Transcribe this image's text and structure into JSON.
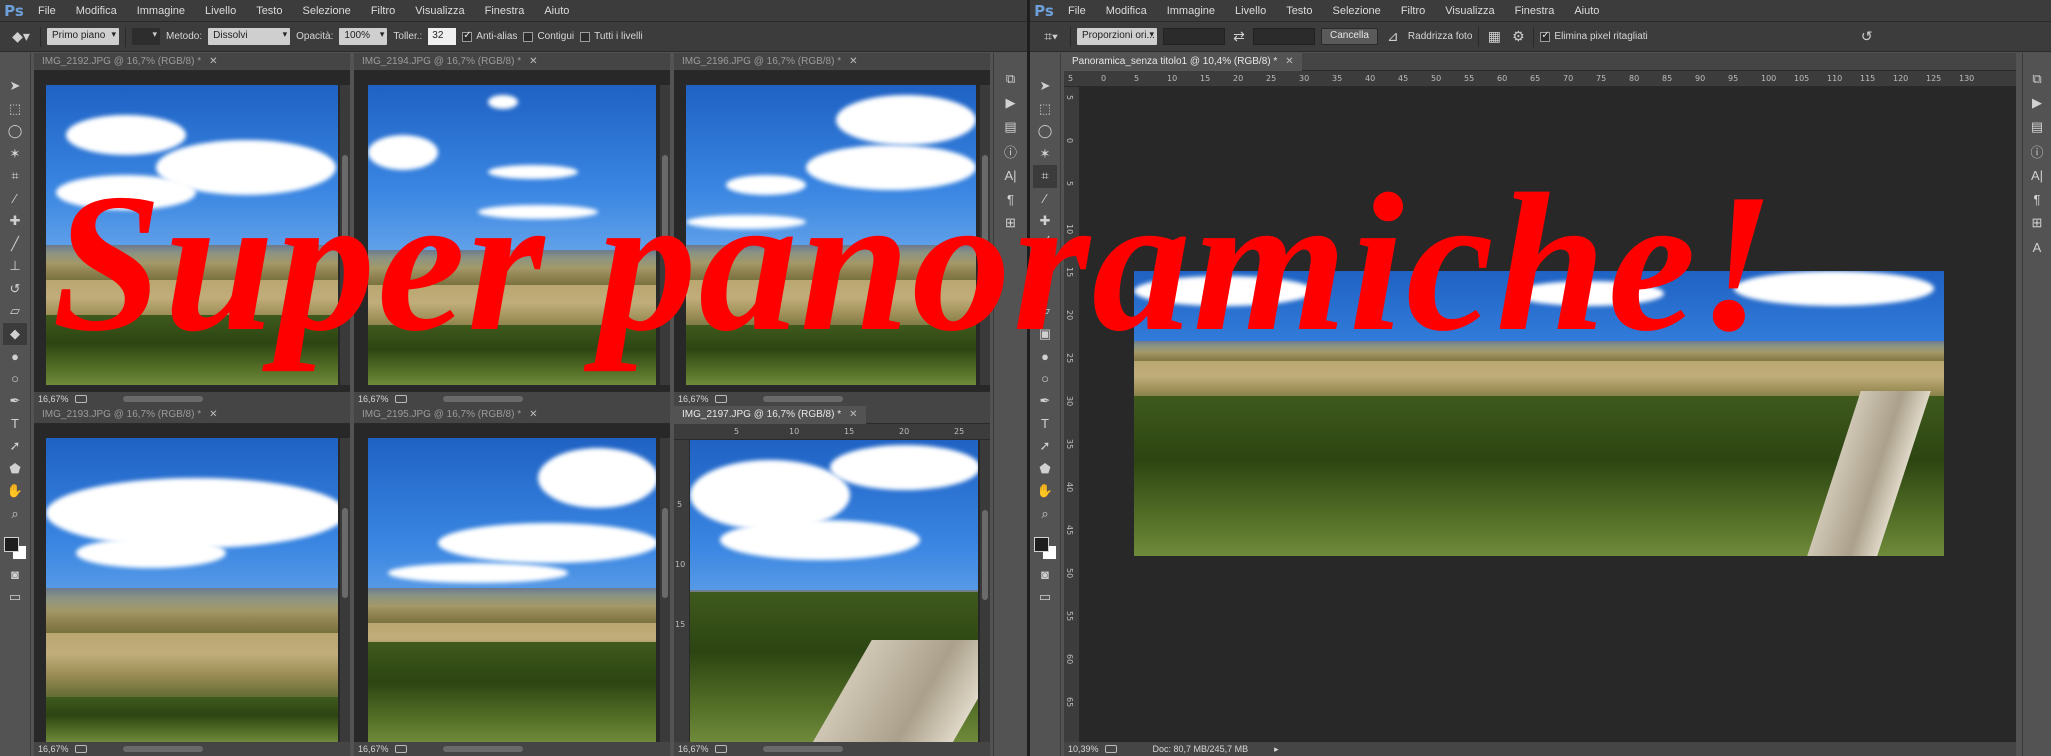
{
  "overlay_title": "Super panoramiche!",
  "left_app": {
    "logo": "Ps",
    "menu": [
      "File",
      "Modifica",
      "Immagine",
      "Livello",
      "Testo",
      "Selezione",
      "Filtro",
      "Visualizza",
      "Finestra",
      "Aiuto"
    ],
    "options": {
      "tool_icon": "paint-bucket-icon",
      "fill_source": "Primo piano",
      "method_label": "Metodo:",
      "method_value": "Dissolvi",
      "opacity_label": "Opacità:",
      "opacity_value": "100%",
      "tolerance_label": "Toller.:",
      "tolerance_value": "32",
      "anti_alias": "Anti-alias",
      "contiguous": "Contigui",
      "all_layers": "Tutti i livelli"
    },
    "documents": [
      {
        "tab": "IMG_2192.JPG @ 16,7% (RGB/8) *",
        "zoom": "16,67%"
      },
      {
        "tab": "IMG_2194.JPG @ 16,7% (RGB/8) *",
        "zoom": "16,67%"
      },
      {
        "tab": "IMG_2196.JPG @ 16,7% (RGB/8) *",
        "zoom": "16,67%"
      },
      {
        "tab": "IMG_2193.JPG @ 16,7% (RGB/8) *",
        "zoom": "16,67%"
      },
      {
        "tab": "IMG_2195.JPG @ 16,7% (RGB/8) *",
        "zoom": "16,67%"
      },
      {
        "tab": "IMG_2197.JPG @ 16,7% (RGB/8) *",
        "zoom": "16,67%"
      }
    ],
    "doc6_ruler_h": [
      "5",
      "10",
      "15",
      "20",
      "25"
    ],
    "doc6_ruler_v": [
      "5",
      "10",
      "15"
    ]
  },
  "right_app": {
    "logo": "Ps",
    "menu": [
      "File",
      "Modifica",
      "Immagine",
      "Livello",
      "Testo",
      "Selezione",
      "Filtro",
      "Visualizza",
      "Finestra",
      "Aiuto"
    ],
    "options": {
      "tool_icon": "crop-icon",
      "ratio_value": "Proporzioni ori...",
      "cancel_label": "Cancella",
      "straighten_label": "Raddrizza foto",
      "delete_pixels_label": "Elimina pixel ritagliati"
    },
    "document": {
      "tab": "Panoramica_senza titolo1 @ 10,4% (RGB/8) *",
      "zoom": "10,39%",
      "doc_info": "Doc: 80,7 MB/245,7 MB"
    },
    "ruler_h": [
      "5",
      "0",
      "5",
      "10",
      "15",
      "20",
      "25",
      "30",
      "35",
      "40",
      "45",
      "50",
      "55",
      "60",
      "65",
      "70",
      "75",
      "80",
      "85",
      "90",
      "95",
      "100",
      "105",
      "110",
      "115",
      "120",
      "125",
      "130"
    ],
    "ruler_v": [
      "5",
      "0",
      "5",
      "10",
      "15",
      "20",
      "25",
      "30",
      "35",
      "40",
      "45",
      "50",
      "55",
      "60",
      "65"
    ]
  },
  "colors": {
    "title_red": "#ff0000",
    "ui_dark": "#535353",
    "menubar": "#3c3c3c",
    "canvas_bg": "#282828"
  }
}
